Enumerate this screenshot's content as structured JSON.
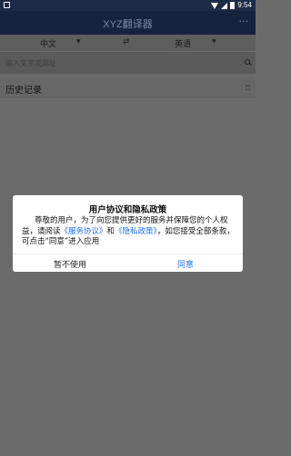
{
  "status_bar": {
    "time": "9:54"
  },
  "app_bar": {
    "title": "XYZ翻译器",
    "more": "···"
  },
  "language": {
    "source": "中文",
    "target": "英语",
    "swap": "⇄",
    "caret": "▼"
  },
  "search": {
    "placeholder": "输入文字或网址"
  },
  "history": {
    "label": "历史记录"
  },
  "dialog": {
    "title": "用户协议和隐私政策",
    "body_part1": "尊敬的用户，为了向您提供更好的服务并保障您的个人权益，请阅读",
    "terms_link": "《服务协议》",
    "and": "和",
    "privacy_link": "《隐私政策》",
    "body_part2": "，如您接受全部条款，可点击“同意”进入应用",
    "decline_label": "暂不使用",
    "agree_label": "同意"
  },
  "colors": {
    "link": "#1e6ff1",
    "app_bar": "#15233e"
  }
}
